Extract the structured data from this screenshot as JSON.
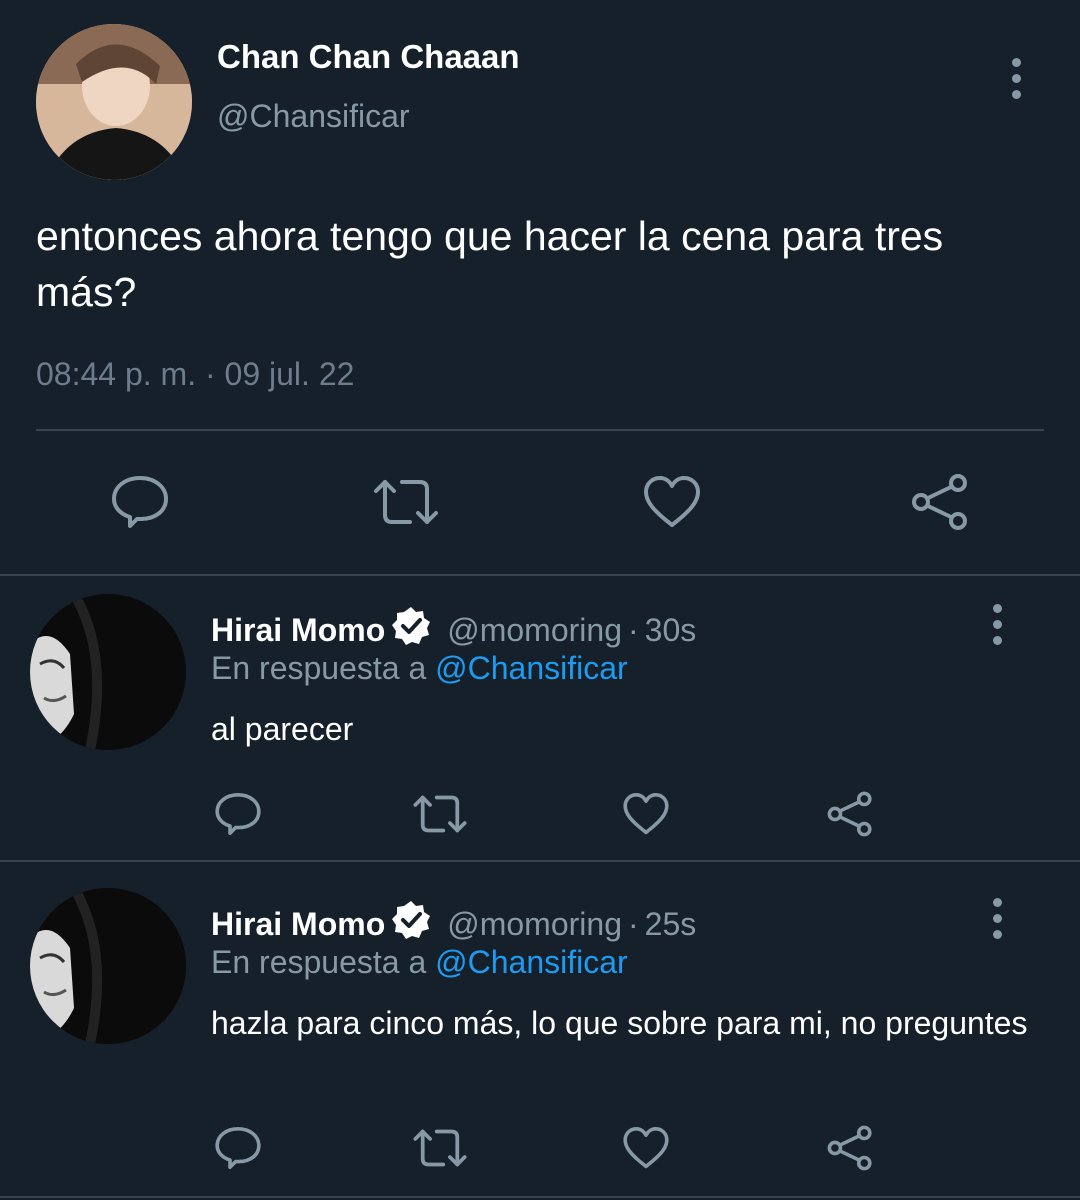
{
  "main_tweet": {
    "display_name": "Chan Chan Chaaan",
    "handle": "@Chansificar",
    "text": "entonces ahora tengo que hacer la cena para tres más?",
    "time": "08:44 p. m.",
    "separator": "·",
    "date": "09 jul. 22"
  },
  "replies": [
    {
      "display_name": "Hirai Momo",
      "handle": "@momoring",
      "separator": "·",
      "age": "30s",
      "reply_prefix": "En respuesta a",
      "reply_to": "@Chansificar",
      "text": "al parecer"
    },
    {
      "display_name": "Hirai Momo",
      "handle": "@momoring",
      "separator": "·",
      "age": "25s",
      "reply_prefix": "En respuesta a",
      "reply_to": "@Chansificar",
      "text": "hazla para cinco más, lo que sobre para mi, no preguntes"
    }
  ],
  "icons": [
    "more-vertical-icon",
    "reply-icon",
    "retweet-icon",
    "like-icon",
    "share-icon",
    "verified-icon"
  ],
  "colors": {
    "background": "#15202b",
    "secondary_text": "#8899a6",
    "link": "#1d9bf0",
    "divider": "#38444d"
  }
}
